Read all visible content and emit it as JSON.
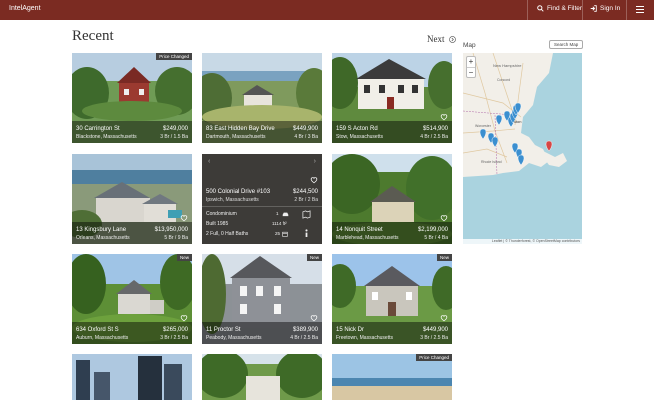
{
  "header": {
    "brand": "IntelAgent",
    "find_filter": "Find & Filter",
    "sign_in": "Sign In"
  },
  "section": {
    "title": "Recent",
    "next": "Next"
  },
  "listings": [
    {
      "address": "30 Carrington St",
      "city": "Blackstone, Massachusetts",
      "price": "$249,000",
      "beds": "3 Br / 1.5 Ba",
      "badge": "Price Changed"
    },
    {
      "address": "83 East Hidden Bay Drive",
      "city": "Dartmouth, Massachusetts",
      "price": "$449,900",
      "beds": "4 Br / 3 Ba",
      "badge": ""
    },
    {
      "address": "159 S Acton Rd",
      "city": "Stow, Massachusetts",
      "price": "$514,900",
      "beds": "4 Br / 2.5 Ba",
      "badge": ""
    },
    {
      "address": "13 Kingsbury Lane",
      "city": "Orleans, Massachusetts",
      "price": "$13,950,000",
      "beds": "5 Br / 9 Ba",
      "badge": ""
    },
    {
      "address": "14 Nonquit Street",
      "city": "Marblehead, Massachusetts",
      "price": "$2,199,000",
      "beds": "5 Br / 4 Ba",
      "badge": ""
    },
    {
      "address": "634 Oxford St S",
      "city": "Auburn, Massachusetts",
      "price": "$265,000",
      "beds": "3 Br / 2.5 Ba",
      "badge": "New"
    },
    {
      "address": "11 Proctor St",
      "city": "Peabody, Massachusetts",
      "price": "$389,900",
      "beds": "4 Br / 2.5 Ba",
      "badge": "New"
    },
    {
      "address": "15 Nick Dr",
      "city": "Freetown, Massachusetts",
      "price": "$449,900",
      "beds": "3 Br / 2.5 Ba",
      "badge": "New"
    },
    {
      "address": "",
      "city": "",
      "price": "",
      "beds": "",
      "badge": ""
    },
    {
      "address": "",
      "city": "",
      "price": "",
      "beds": "",
      "badge": ""
    },
    {
      "address": "",
      "city": "",
      "price": "",
      "beds": "",
      "badge": "Price Changed"
    }
  ],
  "detail": {
    "address": "500 Colonial Drive #103",
    "city": "Ipswich, Massachusetts",
    "price": "$244,500",
    "beds": "2 Br / 2 Ba",
    "type": "Condominium",
    "built": "Built 1985",
    "baths": "2 Full, 0 Half Baths",
    "garage": "1",
    "sqft": "1114 ft²",
    "dom": "25"
  },
  "map": {
    "title": "Map",
    "search_button": "Search Map",
    "zoom_in": "+",
    "zoom_out": "−",
    "attribution": "Leaflet | © Thunderforest, © OpenStreetMap contributors",
    "labels": [
      "New Hampshire",
      "Concord",
      "Worcester",
      "Boston",
      "Rhode Island"
    ]
  },
  "colors": {
    "header": "#7b2b22",
    "marker": "#3b8fd0",
    "marker_active": "#d64545"
  }
}
